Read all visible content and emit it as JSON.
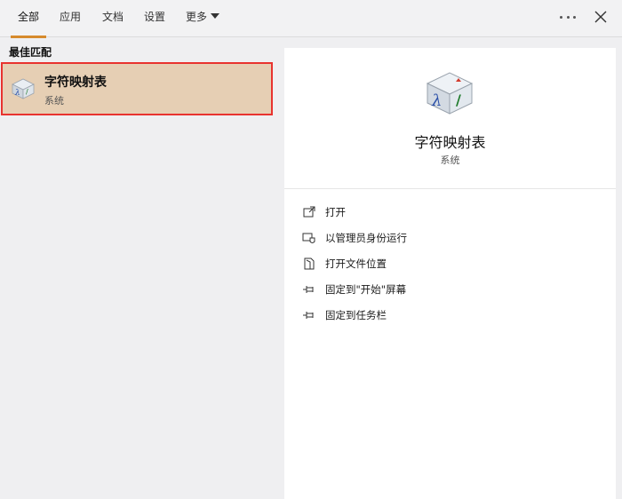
{
  "tabs": [
    {
      "label": "全部",
      "active": true
    },
    {
      "label": "应用",
      "active": false
    },
    {
      "label": "文档",
      "active": false
    },
    {
      "label": "设置",
      "active": false
    },
    {
      "label": "更多",
      "active": false
    }
  ],
  "toolbar": {
    "more_icon": "ellipsis-icon",
    "close_icon": "close-icon"
  },
  "best_match": {
    "section_title": "最佳匹配",
    "title": "字符映射表",
    "subtitle": "系统",
    "icon": "character-map-icon"
  },
  "detail": {
    "title": "字符映射表",
    "subtitle": "系统",
    "icon": "character-map-icon"
  },
  "actions": [
    {
      "label": "打开",
      "icon": "open-icon"
    },
    {
      "label": "以管理员身份运行",
      "icon": "run-as-admin-icon"
    },
    {
      "label": "打开文件位置",
      "icon": "file-location-icon"
    },
    {
      "label": "固定到\"开始\"屏幕",
      "icon": "pin-icon"
    },
    {
      "label": "固定到任务栏",
      "icon": "pin-icon"
    }
  ],
  "colors": {
    "accent_underline": "#d68a2c",
    "selection_bg": "#e6cfb4",
    "highlight_border": "#e8332f"
  }
}
